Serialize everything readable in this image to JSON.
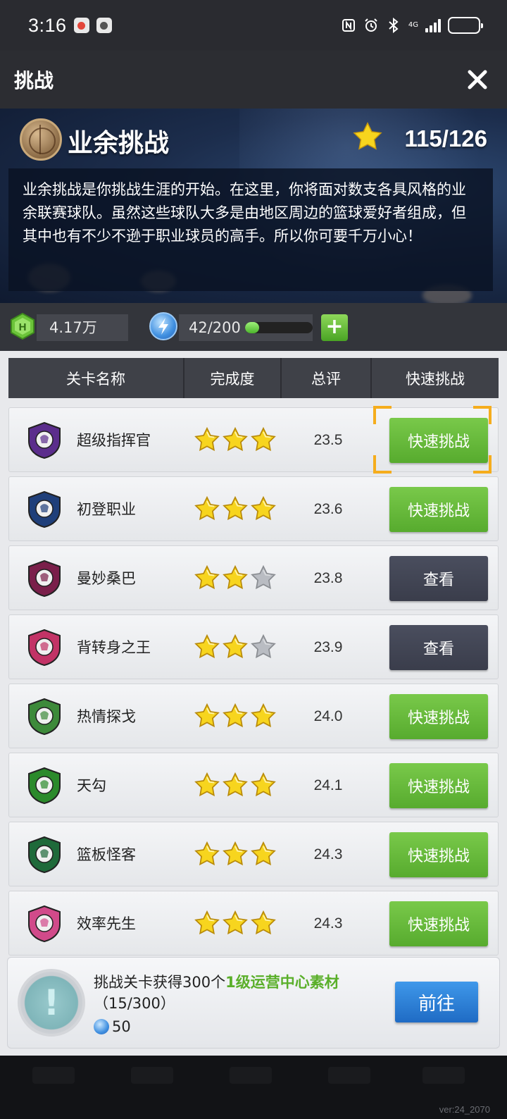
{
  "status_bar": {
    "time": "3:16",
    "network": "4G",
    "notification_colors": [
      "#e3463a",
      "#555555"
    ]
  },
  "header": {
    "title": "挑战",
    "close_icon": "close-icon"
  },
  "banner": {
    "title": "业余挑战",
    "stars_progress": "115/126",
    "description": "业余挑战是你挑战生涯的开始。在这里，你将面对数支各具风格的业余联赛球队。虽然这些球队大多是由地区周边的篮球爱好者组成，但其中也有不少不逊于职业球员的高手。所以你可要千万小心！"
  },
  "resources": {
    "coins": "4.17万",
    "energy": "42/200",
    "energy_fraction": 0.21,
    "add_label": "+"
  },
  "table": {
    "headers": [
      "关卡名称",
      "完成度",
      "总评",
      "快速挑战"
    ],
    "rows": [
      {
        "name": "超级指挥官",
        "stars": 3,
        "score": "23.5",
        "action": "快速挑战",
        "action_type": "quick",
        "logo": "purple-knight-logo",
        "logo_color": "#5b2d8c"
      },
      {
        "name": "初登职业",
        "stars": 3,
        "score": "23.6",
        "action": "快速挑战",
        "action_type": "quick",
        "logo": "blue-shield-fox-logo",
        "logo_color": "#1f3f7a"
      },
      {
        "name": "曼妙桑巴",
        "stars": 2,
        "score": "23.8",
        "action": "查看",
        "action_type": "view",
        "logo": "dragon-shield-logo",
        "logo_color": "#7a1f4a"
      },
      {
        "name": "背转身之王",
        "stars": 2,
        "score": "23.9",
        "action": "查看",
        "action_type": "view",
        "logo": "pink-warrior-logo",
        "logo_color": "#c23366"
      },
      {
        "name": "热情探戈",
        "stars": 3,
        "score": "24.0",
        "action": "快速挑战",
        "action_type": "quick",
        "logo": "green-hulk-logo",
        "logo_color": "#3d8a3a"
      },
      {
        "name": "天勾",
        "stars": 3,
        "score": "24.1",
        "action": "快速挑战",
        "action_type": "quick",
        "logo": "green-dragon-logo",
        "logo_color": "#2b8a2b"
      },
      {
        "name": "篮板怪客",
        "stars": 3,
        "score": "24.3",
        "action": "快速挑战",
        "action_type": "quick",
        "logo": "tiger-logo",
        "logo_color": "#1f6a3a"
      },
      {
        "name": "效率先生",
        "stars": 3,
        "score": "24.3",
        "action": "快速挑战",
        "action_type": "quick",
        "logo": "pink-unicorn-logo",
        "logo_color": "#d14a8a"
      }
    ]
  },
  "task": {
    "text_prefix": "挑战关卡获得300个",
    "text_highlight": "1级运营中心素材",
    "progress": "（15/300）",
    "reward": "50",
    "go_label": "前往",
    "icon_symbol": "!"
  },
  "footer": {
    "version": "ver:24_2070"
  },
  "colors": {
    "quick_button": "#63b63a",
    "view_button": "#42465a",
    "highlight": "#5aaf2a",
    "star_gold": "#f5d21f",
    "focus_bracket": "#f5ad1d"
  }
}
